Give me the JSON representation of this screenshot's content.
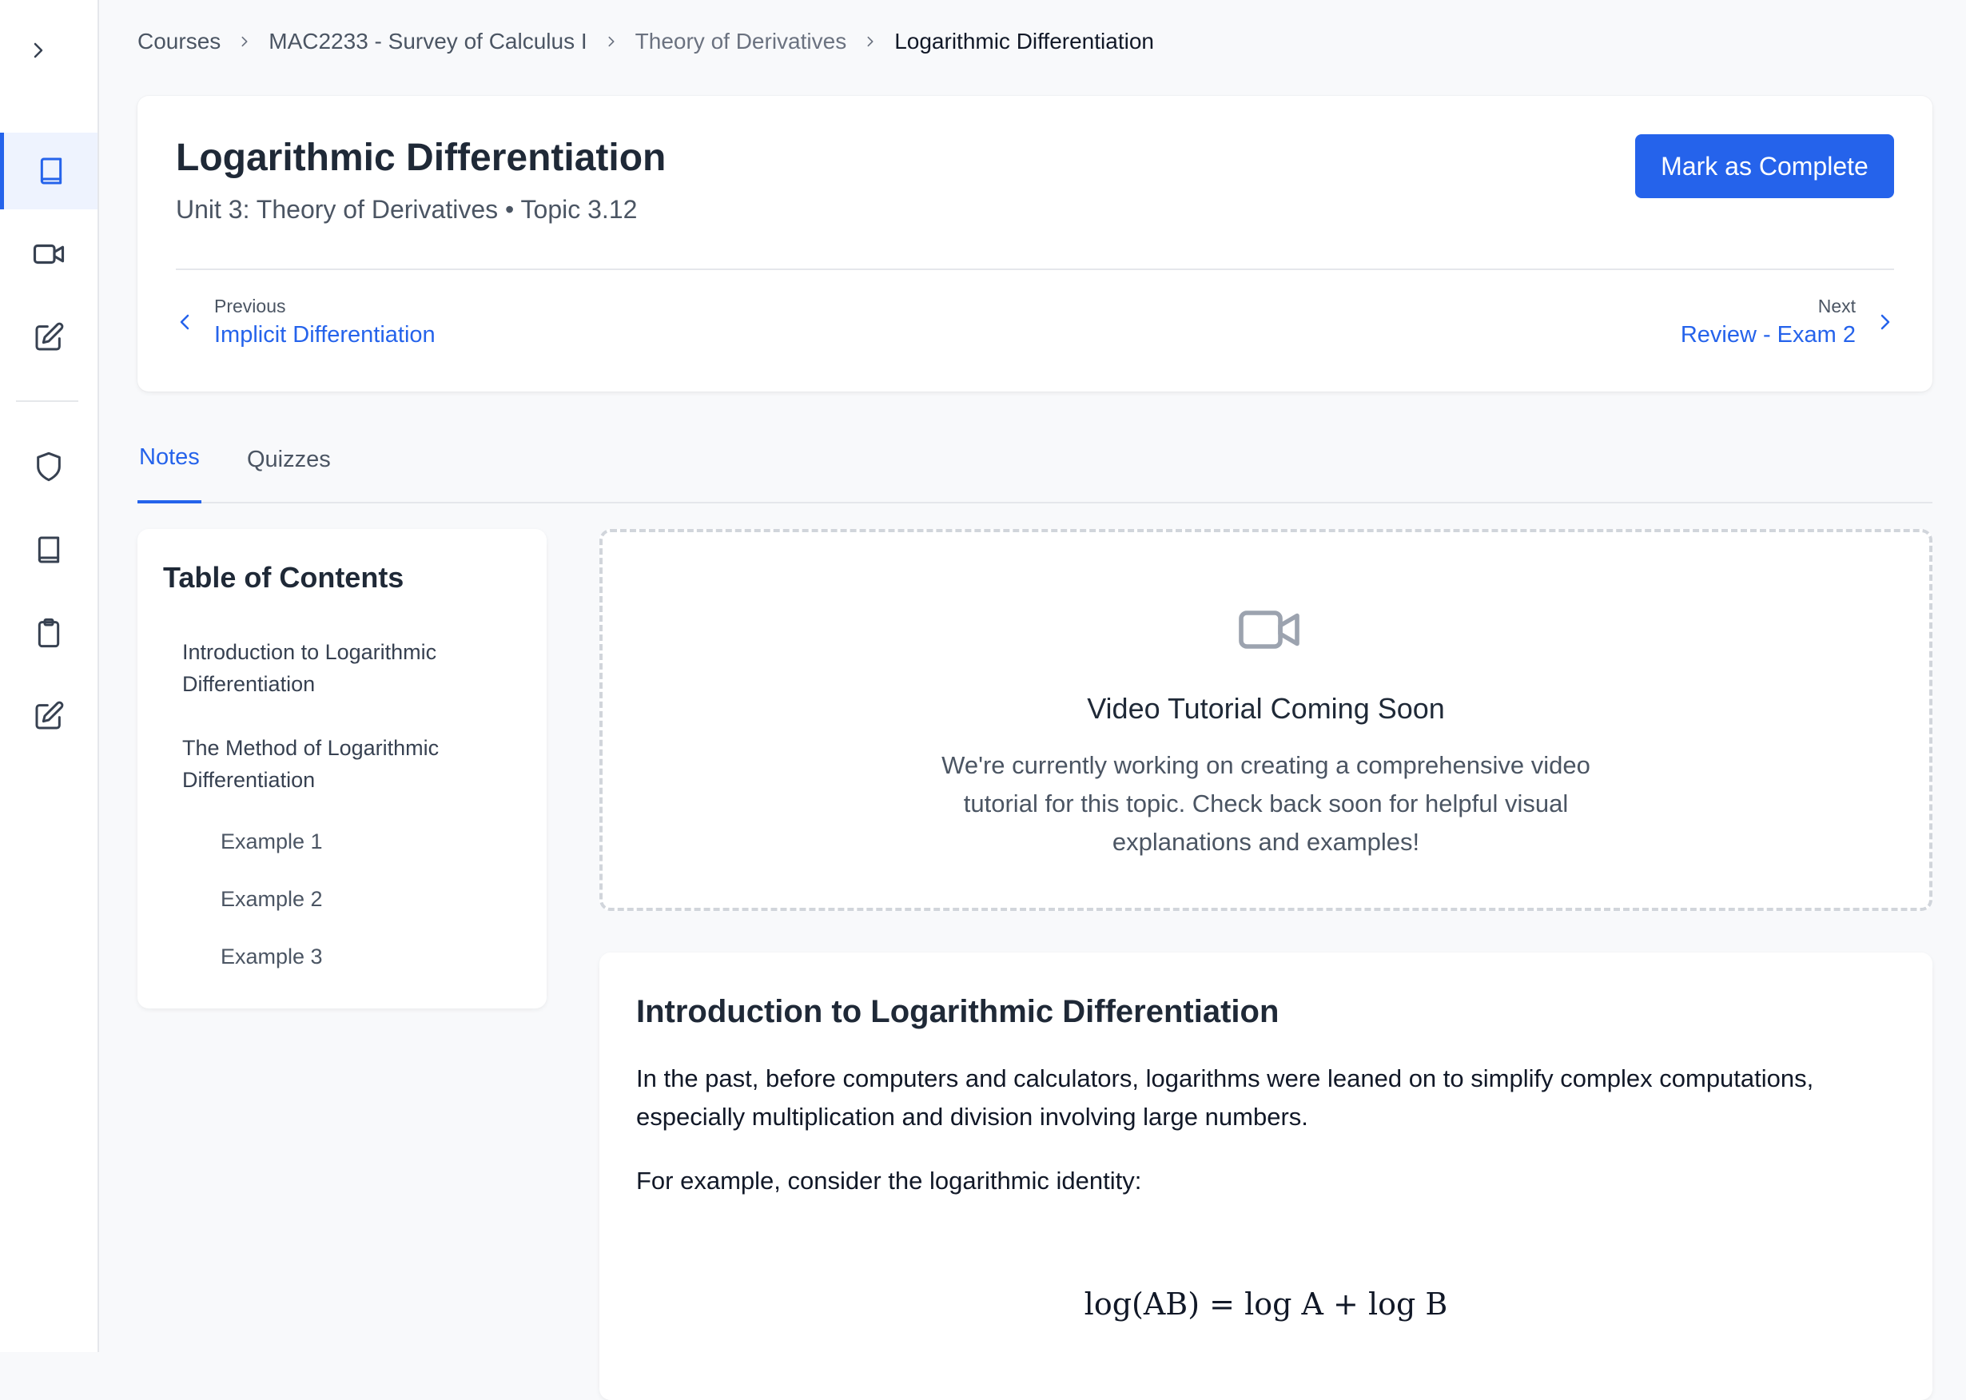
{
  "breadcrumb": {
    "items": [
      "Courses",
      "MAC2233 - Survey of Calculus I",
      "Theory of Derivatives",
      "Logarithmic Differentiation"
    ]
  },
  "header": {
    "title": "Logarithmic Differentiation",
    "subtitle": "Unit 3: Theory of Derivatives • Topic 3.12",
    "complete_label": "Mark as Complete",
    "prev_label": "Previous",
    "prev_link": "Implicit Differentiation",
    "next_label": "Next",
    "next_link": "Review - Exam 2"
  },
  "tabs": [
    "Notes",
    "Quizzes"
  ],
  "toc": {
    "title": "Table of Contents",
    "items": [
      "Introduction to Logarithmic Differentiation",
      "The Method of Logarithmic Differentiation"
    ],
    "sub_items": [
      "Example 1",
      "Example 2",
      "Example 3"
    ]
  },
  "video": {
    "title": "Video Tutorial Coming Soon",
    "description": "We're currently working on creating a comprehensive video tutorial for this topic. Check back soon for helpful visual explanations and examples!"
  },
  "content": {
    "section_title": "Introduction to Logarithmic Differentiation",
    "paragraph_1": "In the past, before computers and calculators, logarithms were leaned on to simplify complex computations, especially multiplication and division involving large numbers.",
    "paragraph_2": "For example, consider the logarithmic identity:",
    "formula_lhs": "log(AB)",
    "formula_eq": "=",
    "formula_rhs": "log A + log B"
  },
  "sidebar_icons": [
    "chevron-right-icon",
    "book-icon",
    "video-icon",
    "edit-icon",
    "shield-icon",
    "book-icon",
    "clipboard-icon",
    "edit-icon"
  ],
  "colors": {
    "accent": "#2563eb",
    "active_bg": "#eef3fe",
    "muted": "#4b5563"
  }
}
